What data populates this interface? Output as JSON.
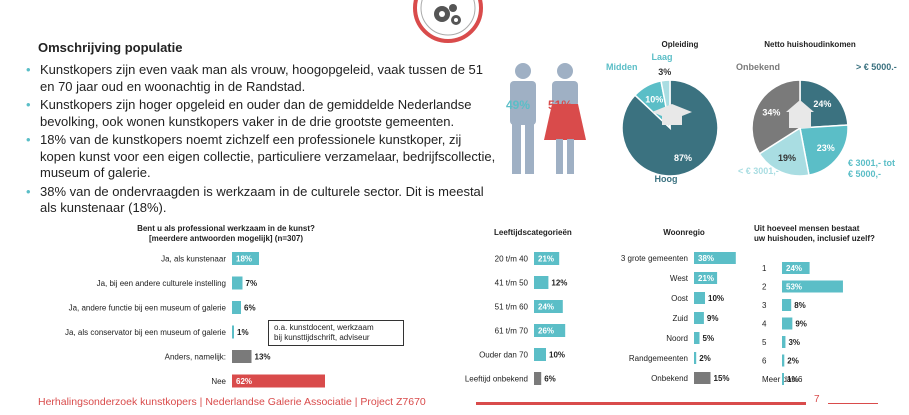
{
  "header": {
    "title": "Omschrijving populatie",
    "bullets": [
      "Kunstkopers zijn even vaak man als vrouw, hoogopgeleid, vaak tussen de 51 en 70 jaar oud en woonachtig in de Randstad.",
      "Kunstkopers zijn hoger opgeleid en ouder dan de gemiddelde Nederlandse bevolking, ook wonen kunstkopers vaker in de drie grootste gemeenten.",
      "18% van de kunstkopers noemt zichzelf een professionele kunstkoper, zij kopen kunst voor een eigen collectie, particuliere verzamelaar, bedrijfscollectie, museum of galerie.",
      "38% van de ondervraagden is werkzaam in de culturele sector. Dit is meestal als kunstenaar (18%)."
    ]
  },
  "gender": {
    "male_pct": "49%",
    "female_pct": "51%",
    "male_color": "#5bbec7",
    "female_color": "#d94b4b"
  },
  "callout": {
    "text_line1": "o.a. kunstdocent, werkzaam",
    "text_line2": "bij kunsttijdschrift, adviseur"
  },
  "footer": {
    "text": "Herhalingsonderzoek kunstkopers | Nederlandse Galerie Associatie | Project Z7670",
    "page_number": "7"
  },
  "colors": {
    "teal": "#5bbec7",
    "dark_teal": "#3b7280",
    "light_teal": "#a9dde2",
    "grey": "#7a7a7a",
    "red": "#d94b4b"
  },
  "chart_data": [
    {
      "id": "opleiding",
      "type": "pie",
      "title": "Opleiding",
      "slices": [
        {
          "label": "Hoog",
          "value": 87,
          "display": "87%",
          "color": "#3b7280"
        },
        {
          "label": "Midden",
          "value": 10,
          "display": "10%",
          "color": "#5bbec7"
        },
        {
          "label": "Laag",
          "value": 3,
          "display": "3%",
          "color": "#a9dde2"
        }
      ]
    },
    {
      "id": "inkomen",
      "type": "pie",
      "title": "Netto huishoudinkomen",
      "slices": [
        {
          "label": "> € 5000.-",
          "value": 24,
          "display": "24%",
          "color": "#3b7280"
        },
        {
          "label": "€ 3001,- tot € 5000,-",
          "value": 23,
          "display": "23%",
          "color": "#5bbec7"
        },
        {
          "label": "< € 3001,-",
          "value": 19,
          "display": "19%",
          "color": "#a9dde2"
        },
        {
          "label": "Onbekend",
          "value": 34,
          "display": "34%",
          "color": "#7a7a7a"
        }
      ]
    },
    {
      "id": "professional",
      "type": "bar",
      "title": "Bent u als professional werkzaam in de kunst?",
      "subtitle": "[meerdere antwoorden mogelijk] (n=307)",
      "categories": [
        "Ja, als kunstenaar",
        "Ja, bij een andere culturele instelling",
        "Ja, andere functie bij een museum of galerie",
        "Ja, als conservator bij een museum of galerie",
        "Anders, namelijk:",
        "Nee"
      ],
      "values": [
        18,
        7,
        6,
        1,
        13,
        62
      ],
      "display": [
        "18%",
        "7%",
        "6%",
        "1%",
        "13%",
        "62%"
      ],
      "colors": [
        "#5bbec7",
        "#5bbec7",
        "#5bbec7",
        "#5bbec7",
        "#7a7a7a",
        "#d94b4b"
      ],
      "xlim": [
        0,
        100
      ]
    },
    {
      "id": "leeftijd",
      "type": "bar",
      "title": "Leeftijdscategorieën",
      "categories": [
        "20 t/m 40",
        "41 t/m 50",
        "51 t/m 60",
        "61 t/m 70",
        "Ouder dan 70",
        "Leeftijd onbekend"
      ],
      "values": [
        21,
        12,
        24,
        26,
        10,
        6
      ],
      "display": [
        "21%",
        "12%",
        "24%",
        "26%",
        "10%",
        "6%"
      ],
      "colors": [
        "#5bbec7",
        "#5bbec7",
        "#5bbec7",
        "#5bbec7",
        "#5bbec7",
        "#7a7a7a"
      ],
      "xlim": [
        0,
        100
      ]
    },
    {
      "id": "woonregio",
      "type": "bar",
      "title": "Woonregio",
      "categories": [
        "3 grote gemeenten",
        "West",
        "Oost",
        "Zuid",
        "Noord",
        "Randgemeenten",
        "Onbekend"
      ],
      "values": [
        38,
        21,
        10,
        9,
        5,
        2,
        15
      ],
      "display": [
        "38%",
        "21%",
        "10%",
        "9%",
        "5%",
        "2%",
        "15%"
      ],
      "colors": [
        "#5bbec7",
        "#5bbec7",
        "#5bbec7",
        "#5bbec7",
        "#5bbec7",
        "#5bbec7",
        "#7a7a7a"
      ],
      "xlim": [
        0,
        100
      ]
    },
    {
      "id": "huishouden",
      "type": "bar",
      "title": "Uit hoeveel mensen bestaat",
      "subtitle": "uw huishouden, inclusief uzelf?",
      "categories": [
        "1",
        "2",
        "3",
        "4",
        "5",
        "6",
        "Meer dan 6"
      ],
      "values": [
        24,
        53,
        8,
        9,
        3,
        2,
        1
      ],
      "display": [
        "24%",
        "53%",
        "8%",
        "9%",
        "3%",
        "2%",
        "1%"
      ],
      "colors": [
        "#5bbec7",
        "#5bbec7",
        "#5bbec7",
        "#5bbec7",
        "#5bbec7",
        "#5bbec7",
        "#5bbec7"
      ],
      "xlim": [
        0,
        100
      ]
    }
  ]
}
